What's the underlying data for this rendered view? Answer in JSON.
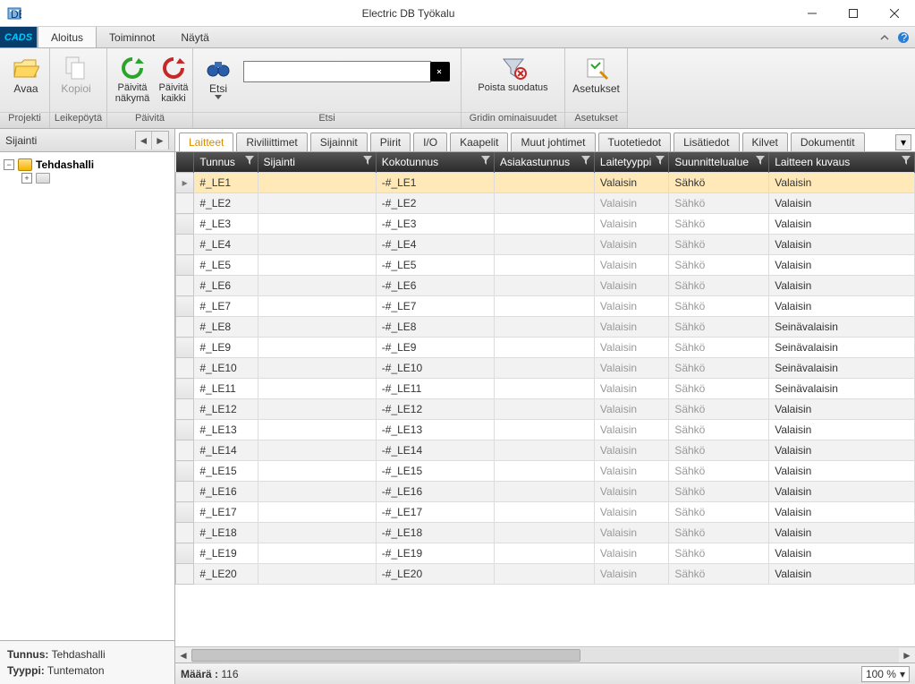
{
  "window": {
    "title": "Electric DB Työkalu"
  },
  "menu": {
    "cads": "CADS",
    "items": [
      "Aloitus",
      "Toiminnot",
      "Näytä"
    ],
    "activeIndex": 0
  },
  "ribbon": {
    "projekti": {
      "open": "Avaa",
      "label": "Projekti"
    },
    "leike": {
      "copy": "Kopioi",
      "label": "Leikepöytä"
    },
    "paivita": {
      "view": "Päivitä näkymä",
      "all": "Päivitä kaikki",
      "label": "Päivitä"
    },
    "etsi": {
      "find": "Etsi",
      "label": "Etsi",
      "input": ""
    },
    "grid": {
      "clear": "Poista suodatus",
      "label": "Gridin ominaisuudet"
    },
    "asetukset": {
      "btn": "Asetukset",
      "label": "Asetukset"
    }
  },
  "leftpane": {
    "title": "Sijainti",
    "tree": {
      "root": "Tehdashalli"
    },
    "info": {
      "tunnus_label": "Tunnus:",
      "tunnus_value": "Tehdashalli",
      "tyyppi_label": "Tyyppi:",
      "tyyppi_value": "Tuntematon"
    }
  },
  "tabs": [
    "Laitteet",
    "Riviliittimet",
    "Sijainnit",
    "Piirit",
    "I/O",
    "Kaapelit",
    "Muut johtimet",
    "Tuotetiedot",
    "Lisätiedot",
    "Kilvet",
    "Dokumentit"
  ],
  "tabActive": 0,
  "columns": [
    "Tunnus",
    "Sijainti",
    "Kokotunnus",
    "Asiakastunnus",
    "Laitetyyppi",
    "Suunnittelualue",
    "Laitteen kuvaus"
  ],
  "rows": [
    {
      "tunnus": "#_LE1",
      "sijainti": "",
      "koko": "-#_LE1",
      "asiakas": "",
      "tyyppi": "Valaisin",
      "alue": "Sähkö",
      "kuvaus": "Valaisin"
    },
    {
      "tunnus": "#_LE2",
      "sijainti": "",
      "koko": "-#_LE2",
      "asiakas": "",
      "tyyppi": "Valaisin",
      "alue": "Sähkö",
      "kuvaus": "Valaisin"
    },
    {
      "tunnus": "#_LE3",
      "sijainti": "",
      "koko": "-#_LE3",
      "asiakas": "",
      "tyyppi": "Valaisin",
      "alue": "Sähkö",
      "kuvaus": "Valaisin"
    },
    {
      "tunnus": "#_LE4",
      "sijainti": "",
      "koko": "-#_LE4",
      "asiakas": "",
      "tyyppi": "Valaisin",
      "alue": "Sähkö",
      "kuvaus": "Valaisin"
    },
    {
      "tunnus": "#_LE5",
      "sijainti": "",
      "koko": "-#_LE5",
      "asiakas": "",
      "tyyppi": "Valaisin",
      "alue": "Sähkö",
      "kuvaus": "Valaisin"
    },
    {
      "tunnus": "#_LE6",
      "sijainti": "",
      "koko": "-#_LE6",
      "asiakas": "",
      "tyyppi": "Valaisin",
      "alue": "Sähkö",
      "kuvaus": "Valaisin"
    },
    {
      "tunnus": "#_LE7",
      "sijainti": "",
      "koko": "-#_LE7",
      "asiakas": "",
      "tyyppi": "Valaisin",
      "alue": "Sähkö",
      "kuvaus": "Valaisin"
    },
    {
      "tunnus": "#_LE8",
      "sijainti": "",
      "koko": "-#_LE8",
      "asiakas": "",
      "tyyppi": "Valaisin",
      "alue": "Sähkö",
      "kuvaus": "Seinävalaisin"
    },
    {
      "tunnus": "#_LE9",
      "sijainti": "",
      "koko": "-#_LE9",
      "asiakas": "",
      "tyyppi": "Valaisin",
      "alue": "Sähkö",
      "kuvaus": "Seinävalaisin"
    },
    {
      "tunnus": "#_LE10",
      "sijainti": "",
      "koko": "-#_LE10",
      "asiakas": "",
      "tyyppi": "Valaisin",
      "alue": "Sähkö",
      "kuvaus": "Seinävalaisin"
    },
    {
      "tunnus": "#_LE11",
      "sijainti": "",
      "koko": "-#_LE11",
      "asiakas": "",
      "tyyppi": "Valaisin",
      "alue": "Sähkö",
      "kuvaus": "Seinävalaisin"
    },
    {
      "tunnus": "#_LE12",
      "sijainti": "",
      "koko": "-#_LE12",
      "asiakas": "",
      "tyyppi": "Valaisin",
      "alue": "Sähkö",
      "kuvaus": "Valaisin"
    },
    {
      "tunnus": "#_LE13",
      "sijainti": "",
      "koko": "-#_LE13",
      "asiakas": "",
      "tyyppi": "Valaisin",
      "alue": "Sähkö",
      "kuvaus": "Valaisin"
    },
    {
      "tunnus": "#_LE14",
      "sijainti": "",
      "koko": "-#_LE14",
      "asiakas": "",
      "tyyppi": "Valaisin",
      "alue": "Sähkö",
      "kuvaus": "Valaisin"
    },
    {
      "tunnus": "#_LE15",
      "sijainti": "",
      "koko": "-#_LE15",
      "asiakas": "",
      "tyyppi": "Valaisin",
      "alue": "Sähkö",
      "kuvaus": "Valaisin"
    },
    {
      "tunnus": "#_LE16",
      "sijainti": "",
      "koko": "-#_LE16",
      "asiakas": "",
      "tyyppi": "Valaisin",
      "alue": "Sähkö",
      "kuvaus": "Valaisin"
    },
    {
      "tunnus": "#_LE17",
      "sijainti": "",
      "koko": "-#_LE17",
      "asiakas": "",
      "tyyppi": "Valaisin",
      "alue": "Sähkö",
      "kuvaus": "Valaisin"
    },
    {
      "tunnus": "#_LE18",
      "sijainti": "",
      "koko": "-#_LE18",
      "asiakas": "",
      "tyyppi": "Valaisin",
      "alue": "Sähkö",
      "kuvaus": "Valaisin"
    },
    {
      "tunnus": "#_LE19",
      "sijainti": "",
      "koko": "-#_LE19",
      "asiakas": "",
      "tyyppi": "Valaisin",
      "alue": "Sähkö",
      "kuvaus": "Valaisin"
    },
    {
      "tunnus": "#_LE20",
      "sijainti": "",
      "koko": "-#_LE20",
      "asiakas": "",
      "tyyppi": "Valaisin",
      "alue": "Sähkö",
      "kuvaus": "Valaisin"
    }
  ],
  "status": {
    "count_label": "Määrä :",
    "count_value": "116",
    "zoom": "100 %"
  }
}
